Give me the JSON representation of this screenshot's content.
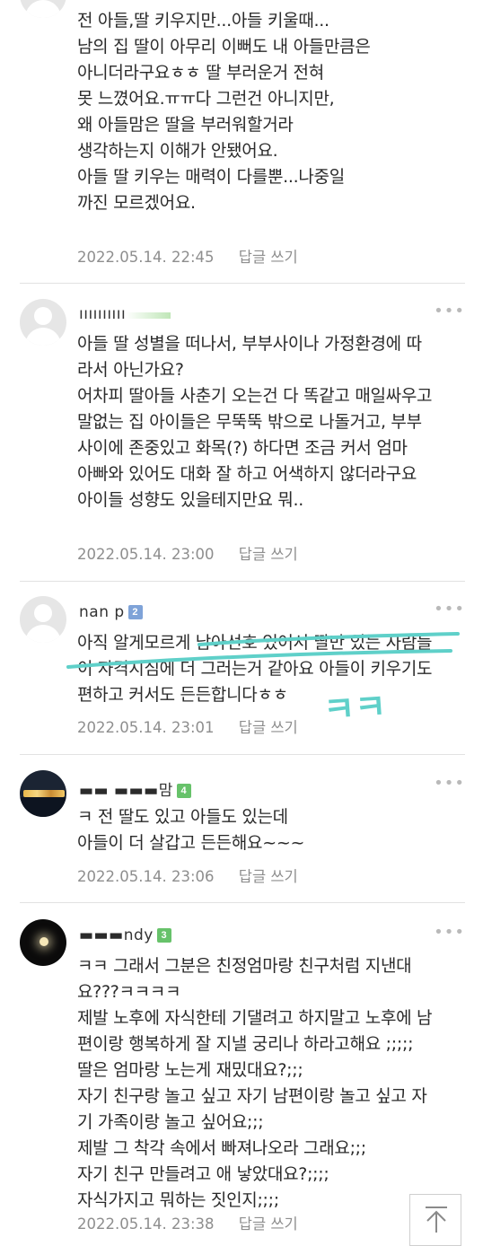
{
  "comments": [
    {
      "nickname": "",
      "level": "",
      "lines": [
        "전 아들,딸 키우지만...아들 키울때...",
        "남의 집 딸이 아무리 이뻐도 내 아들만큼은",
        "아니더라구요ㅎㅎ 딸 부러운거 전혀",
        "못 느꼈어요.ㅠㅠ다 그런건 아니지만,",
        "왜 아들맘은 딸을 부러워할거라",
        "생각하는지 이해가 안됐어요.",
        "아들 딸 키우는 매력이 다를뿐...나중일",
        "까진 모르겠어요."
      ],
      "date": "2022.05.14. 22:45",
      "reply_label": "답글 쓰기"
    },
    {
      "nickname": "ıııııııııı",
      "level": "",
      "lines": [
        "아들 딸 성별을 떠나서, 부부사이나 가정환경에 따",
        "라서 아닌가요?",
        "어차피 딸아들 사춘기 오는건 다 똑같고 매일싸우고",
        "말없는 집 아이들은 무뚝뚝 밖으로 나돌거고, 부부",
        "사이에 존중있고 화목(?) 하다면 조금 커서 엄마",
        "아빠와 있어도 대화 잘 하고 어색하지 않더라구요",
        "아이들 성향도 있을테지만요 뭐.."
      ],
      "date": "2022.05.14. 23:00",
      "reply_label": "답글 쓰기"
    },
    {
      "nickname": "nan p",
      "level": "2",
      "lines": [
        "아직 알게모르게 남아선호 있어서 딸만 있는 사람들",
        "이 자격지심에 더 그러는거 같아요 아들이 키우기도",
        "편하고 커서도 든든합니다ㅎㅎ"
      ],
      "annotation": "ㅋㅋ",
      "date": "2022.05.14. 23:01",
      "reply_label": "답글 쓰기"
    },
    {
      "nickname": "맘",
      "level": "4",
      "lines": [
        "ㅋ 전 딸도 있고 아들도 있는데",
        "아들이 더 살갑고 든든해요~~~"
      ],
      "date": "2022.05.14. 23:06",
      "reply_label": "답글 쓰기"
    },
    {
      "nickname": "ndy",
      "level": "3",
      "lines": [
        "ㅋㅋ 그래서 그분은 친정엄마랑 친구처럼 지낸대",
        "요???ㅋㅋㅋㅋ",
        "제발 노후에 자식한테 기댈려고 하지말고 노후에 남",
        "편이랑 행복하게 잘 지낼 궁리나 하라고해요 ;;;;;",
        "딸은 엄마랑 노는게 재밌대요?;;;",
        "자기 친구랑 놀고 싶고 자기 남편이랑 놀고 싶고 자",
        "기 가족이랑 놀고 싶어요;;;",
        "제발 그 착각 속에서 빠져나오라 그래요;;;",
        "자기 친구 만들려고 애 낳았대요?;;;;",
        "자식가지고 뭐하는 짓인지;;;;"
      ],
      "date": "2022.05.14. 23:38",
      "reply_label": "답글 쓰기"
    }
  ],
  "more_icon": "more-dots-icon",
  "scroll_top_icon": "arrow-up-to-top-icon",
  "colors": {
    "text": "#2a2a2a",
    "meta": "#8e8e8e",
    "divider": "#e2e2e2",
    "annotation": "#5fd0c9",
    "level_blue": "#7fa3d8",
    "level_green": "#67c26a"
  }
}
